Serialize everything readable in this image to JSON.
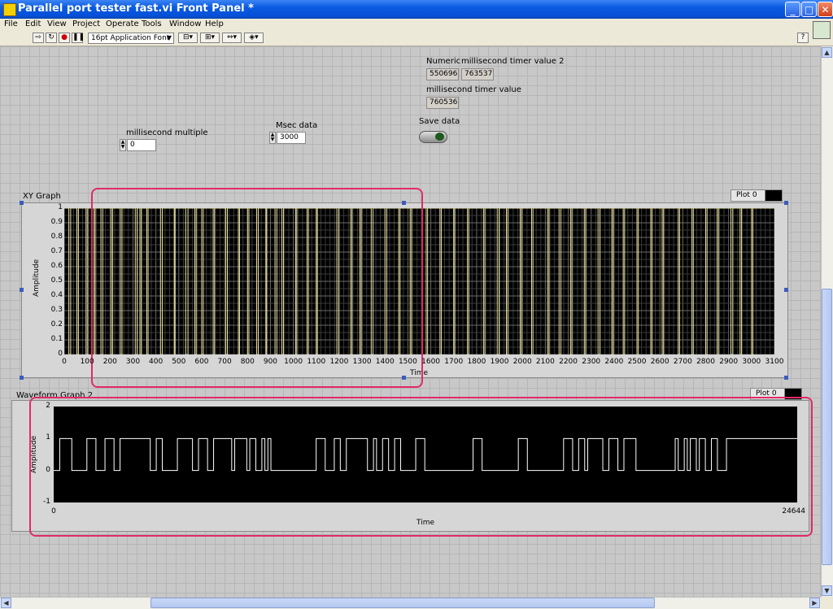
{
  "window": {
    "title": "Parallel port tester fast.vi Front Panel *",
    "minimize": "_",
    "maximize": "□",
    "close": "✕"
  },
  "menu": [
    "File",
    "Edit",
    "View",
    "Project",
    "Operate",
    "Tools",
    "Window",
    "Help"
  ],
  "toolbar": {
    "font": "16pt Application Font",
    "help": "?"
  },
  "controls": {
    "numeric": {
      "label": "Numeric",
      "value": "550696"
    },
    "timer2": {
      "label": "millisecond timer value 2",
      "value": "763537"
    },
    "timer": {
      "label": "millisecond timer value",
      "value": "760536"
    },
    "save": {
      "label": "Save data",
      "state": "on"
    },
    "ms_multiple": {
      "label": "millisecond multiple",
      "value": "0"
    },
    "msec_data": {
      "label": "Msec data",
      "value": "3000"
    }
  },
  "xy_graph": {
    "label": "XY Graph",
    "legend": "Plot 0",
    "xlabel": "Time",
    "ylabel": "Amplitude",
    "yticks": [
      "1",
      "0.9",
      "0.8",
      "0.7",
      "0.6",
      "0.5",
      "0.4",
      "0.3",
      "0.2",
      "0.1",
      "0"
    ],
    "xticks": [
      "0",
      "100",
      "200",
      "300",
      "400",
      "500",
      "600",
      "700",
      "800",
      "900",
      "1000",
      "1100",
      "1200",
      "1300",
      "1400",
      "1500",
      "1600",
      "1700",
      "1800",
      "1900",
      "2000",
      "2100",
      "2200",
      "2300",
      "2400",
      "2500",
      "2600",
      "2700",
      "2800",
      "2900",
      "3000",
      "3100"
    ]
  },
  "waveform_graph": {
    "label": "Waveform Graph 2",
    "legend": "Plot 0",
    "xlabel": "Time",
    "ylabel": "Amplitude",
    "yticks": [
      "2",
      "1",
      "0",
      "-1"
    ],
    "xticks": [
      "0",
      "24644"
    ]
  },
  "colors": {
    "highlight": "#e02a6a",
    "plot_bg": "#000000",
    "xy_line": "#e8e0a0",
    "wave_line": "#ffffff",
    "grid": "#555555"
  },
  "chart_data": [
    {
      "type": "line",
      "title": "XY Graph",
      "xlabel": "Time",
      "ylabel": "Amplitude",
      "xlim": [
        0,
        3100
      ],
      "ylim": [
        0,
        1
      ],
      "grid": true,
      "series": [
        {
          "name": "Plot 0",
          "x_pulses": [
            [
              20,
              28
            ],
            [
              55,
              62
            ],
            [
              95,
              103
            ],
            [
              130,
              135
            ],
            [
              160,
              168
            ],
            [
              205,
              211
            ],
            [
              245,
              252
            ],
            [
              310,
              318
            ],
            [
              330,
              336
            ],
            [
              360,
              366
            ],
            [
              420,
              428
            ],
            [
              480,
              484
            ],
            [
              530,
              540
            ],
            [
              570,
              576
            ],
            [
              600,
              607
            ],
            [
              650,
              656
            ],
            [
              705,
              712
            ],
            [
              760,
              765
            ],
            [
              800,
              806
            ],
            [
              840,
              847
            ],
            [
              880,
              884
            ],
            [
              920,
              928
            ],
            [
              950,
              957
            ],
            [
              1010,
              1015
            ],
            [
              1060,
              1066
            ],
            [
              1100,
              1105
            ],
            [
              1190,
              1198
            ],
            [
              1250,
              1256
            ],
            [
              1290,
              1296
            ],
            [
              1340,
              1348
            ],
            [
              1400,
              1408
            ],
            [
              1460,
              1466
            ],
            [
              1510,
              1516
            ],
            [
              1580,
              1586
            ],
            [
              1640,
              1646
            ],
            [
              1700,
              1705
            ],
            [
              1760,
              1766
            ],
            [
              1830,
              1836
            ],
            [
              1890,
              1898
            ],
            [
              1930,
              1936
            ],
            [
              1990,
              1996
            ],
            [
              2040,
              2046
            ],
            [
              2110,
              2116
            ],
            [
              2160,
              2168
            ],
            [
              2210,
              2216
            ],
            [
              2270,
              2276
            ],
            [
              2330,
              2338
            ],
            [
              2390,
              2396
            ],
            [
              2440,
              2446
            ],
            [
              2500,
              2506
            ],
            [
              2560,
              2566
            ],
            [
              2610,
              2616
            ],
            [
              2680,
              2686
            ],
            [
              2740,
              2746
            ],
            [
              2800,
              2806
            ],
            [
              2850,
              2856
            ],
            [
              2910,
              2918
            ],
            [
              2950,
              2956
            ],
            [
              3000,
              3006
            ]
          ]
        }
      ]
    },
    {
      "type": "line",
      "title": "Waveform Graph 2",
      "xlabel": "Time",
      "ylabel": "Amplitude",
      "xlim": [
        0,
        24644
      ],
      "ylim": [
        -1,
        2
      ],
      "grid": false,
      "series": [
        {
          "name": "Plot 0",
          "high_intervals": [
            [
              200,
              600
            ],
            [
              1100,
              1400
            ],
            [
              1700,
              2000
            ],
            [
              2200,
              3200
            ],
            [
              3400,
              3600
            ],
            [
              4100,
              4600
            ],
            [
              4800,
              5100
            ],
            [
              5300,
              5900
            ],
            [
              6000,
              6400
            ],
            [
              6500,
              6700
            ],
            [
              6900,
              7000
            ],
            [
              7100,
              7200
            ],
            [
              8700,
              9000
            ],
            [
              9300,
              9500
            ],
            [
              9700,
              10400
            ],
            [
              10600,
              10700
            ],
            [
              10900,
              11100
            ],
            [
              11300,
              11500
            ],
            [
              12000,
              12300
            ],
            [
              13900,
              14200
            ],
            [
              15400,
              15700
            ],
            [
              16900,
              17200
            ],
            [
              17400,
              17600
            ],
            [
              17700,
              18200
            ],
            [
              18400,
              18700
            ],
            [
              18900,
              19300
            ],
            [
              20600,
              20700
            ],
            [
              20900,
              21000
            ],
            [
              21100,
              21300
            ],
            [
              21400,
              21600
            ],
            [
              21800,
              22000
            ],
            [
              22300,
              24644
            ]
          ]
        }
      ]
    }
  ]
}
